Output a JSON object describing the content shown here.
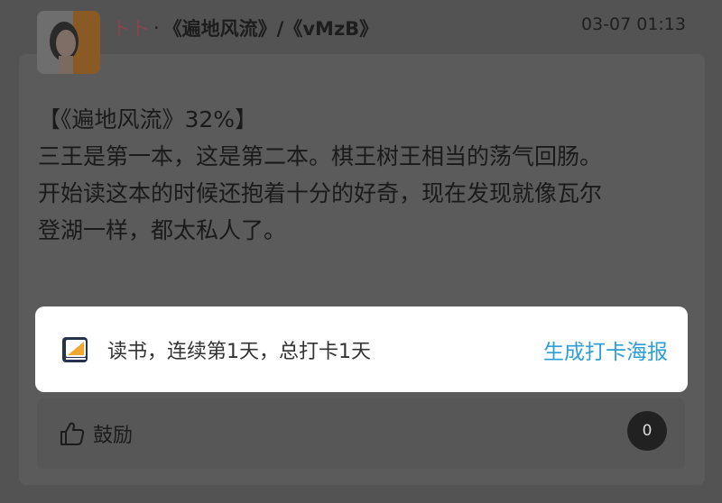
{
  "post": {
    "user_name": "トト",
    "separator": "·",
    "book_path": "《遍地风流》/《vMzB》",
    "time": "03-07 01:13",
    "lines": [
      "【《遍地风流》32%】",
      "三王是第一本，这是第二本。棋王树王相当的荡气回肠。",
      "开始读这本的时候还抱着十分的好奇，现在发现就像瓦尔",
      "登湖一样，都太私人了。"
    ]
  },
  "checkin": {
    "text": "读书，连续第1天，总打卡1天",
    "poster_link": "生成打卡海报"
  },
  "actions": {
    "like_label": "鼓励",
    "comment_count": "0"
  },
  "colors": {
    "overlay": "#535353",
    "link": "#2e9ed6",
    "user_name": "#8a4450",
    "icon_orange": "#f0a830",
    "icon_navy": "#27334d"
  },
  "icons": [
    "avatar",
    "book-icon",
    "thumbs-up-icon"
  ]
}
